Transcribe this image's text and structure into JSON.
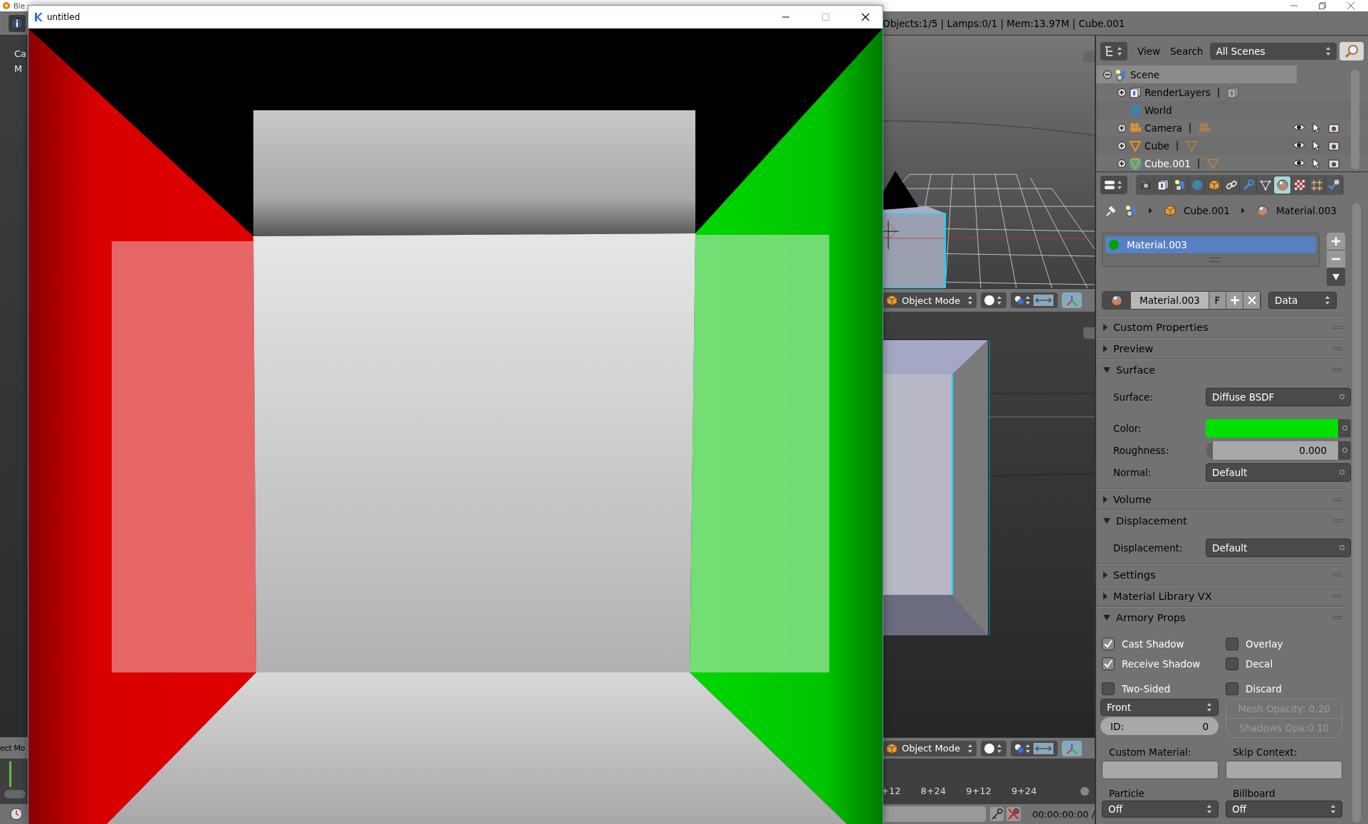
{
  "app_title": "Ble",
  "info_bar": {
    "stats": "Objects:1/5 | Lamps:0/1 | Mem:13.97M | Cube.001"
  },
  "left_area": {
    "texts": [
      "Ca",
      "M"
    ],
    "header_mode": "ect Mo"
  },
  "viewports": [
    {
      "mode": "Object Mode"
    },
    {
      "mode": "Object Mode"
    }
  ],
  "timeline": {
    "ticks": [
      "+12",
      "8+24",
      "9+12",
      "9+24"
    ],
    "timecode": "00:00:00:00 /"
  },
  "render_window": {
    "title": "untitled"
  },
  "outliner": {
    "menus": [
      "View",
      "Search"
    ],
    "filter": "All Scenes",
    "tree": [
      {
        "label": "Scene",
        "kind": "scene",
        "expanded": true,
        "selected": false,
        "restrict": false,
        "children": [
          {
            "label": "RenderLayers",
            "kind": "render_layers",
            "expanded": false,
            "selected": false,
            "restrict": false
          },
          {
            "label": "World",
            "kind": "world",
            "expanded": false,
            "selected": false,
            "restrict": false
          },
          {
            "label": "Camera",
            "kind": "camera",
            "expanded": false,
            "selected": false,
            "restrict": true
          },
          {
            "label": "Cube",
            "kind": "mesh",
            "expanded": false,
            "selected": false,
            "restrict": true
          },
          {
            "label": "Cube.001",
            "kind": "mesh",
            "expanded": false,
            "selected": true,
            "restrict": true
          }
        ]
      }
    ]
  },
  "properties": {
    "tabs": [
      {
        "kind": "render",
        "selected": false
      },
      {
        "kind": "render_layers",
        "selected": false
      },
      {
        "kind": "scene",
        "selected": false
      },
      {
        "kind": "world",
        "selected": false
      },
      {
        "kind": "object",
        "selected": false
      },
      {
        "kind": "constraints",
        "selected": false
      },
      {
        "kind": "modifiers",
        "selected": false
      },
      {
        "kind": "data",
        "selected": false
      },
      {
        "kind": "material",
        "selected": true
      },
      {
        "kind": "texture",
        "selected": false
      },
      {
        "kind": "particles",
        "selected": false
      },
      {
        "kind": "physics",
        "selected": false
      }
    ],
    "breadcrumb": [
      "Cube.001",
      "Material.003"
    ],
    "slots": [
      {
        "name": "Material.003",
        "color": "#00a000",
        "selected": true
      }
    ],
    "datablock": {
      "name": "Material.003",
      "fake_user": "F",
      "link": "Data"
    },
    "panels": [
      {
        "title": "Custom Properties",
        "expanded": false
      },
      {
        "title": "Preview",
        "expanded": false
      },
      {
        "title": "Surface",
        "expanded": true,
        "fields": [
          {
            "kind": "menu",
            "label": "Surface:",
            "value": "Diffuse BSDF"
          },
          {
            "kind": "color",
            "label": "Color:",
            "color": "#00e000"
          },
          {
            "kind": "slider",
            "label": "Roughness:",
            "value": "0.000",
            "level": 0
          },
          {
            "kind": "menu",
            "label": "Normal:",
            "value": "Default"
          }
        ]
      },
      {
        "title": "Volume",
        "expanded": false
      },
      {
        "title": "Displacement",
        "expanded": true,
        "fields": [
          {
            "kind": "menu",
            "label": "Displacement:",
            "value": "Default"
          }
        ]
      },
      {
        "title": "Settings",
        "expanded": false
      },
      {
        "title": "Material Library VX",
        "expanded": false
      },
      {
        "title": "Armory Props",
        "expanded": true
      }
    ],
    "armory": {
      "checks": [
        {
          "label": "Cast Shadow",
          "checked": true
        },
        {
          "label": "Overlay",
          "checked": false
        },
        {
          "label": "Receive Shadow",
          "checked": true
        },
        {
          "label": "Decal",
          "checked": false
        },
        {
          "label": "Two-Sided",
          "checked": false
        },
        {
          "label": "Discard",
          "checked": false
        }
      ],
      "face": "Front",
      "id": {
        "label": "ID:",
        "value": "0"
      },
      "opacity_fields": [
        {
          "text": "Mesh Opacity: 0.20",
          "disabled": true
        },
        {
          "text": "Shadows Opa:0.10",
          "disabled": true
        }
      ],
      "text_fields": [
        {
          "label": "Custom Material:"
        },
        {
          "label": "Skip Context:"
        }
      ],
      "menus": [
        {
          "label": "Particle",
          "value": "Off"
        },
        {
          "label": "Billboard",
          "value": "Off"
        }
      ]
    }
  }
}
